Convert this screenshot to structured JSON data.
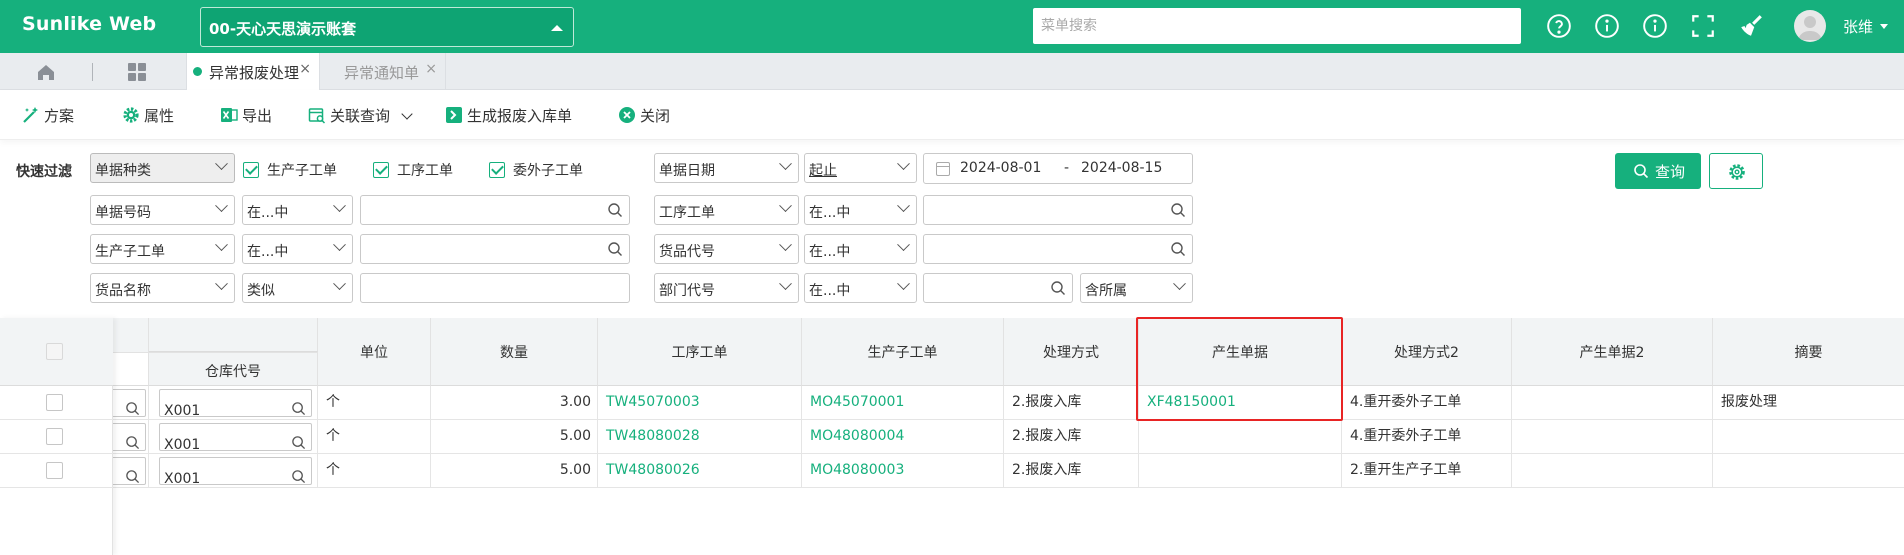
{
  "header": {
    "logo": "Sunlike Web",
    "company": "00-天心天思演示账套",
    "menu_search_placeholder": "菜单搜索",
    "user_name": "张维",
    "brand_color": "#16b07d",
    "icons": [
      "help-circle-icon",
      "info-icon",
      "info-icon",
      "fullscreen-icon",
      "broom-icon"
    ]
  },
  "tabs": {
    "active_label": "异常报废处理",
    "inactive_label": "异常通知单",
    "close_glyph": "×"
  },
  "toolbar": {
    "plan": "方案",
    "attribute": "属性",
    "export": "导出",
    "related_query": "关联查询",
    "generate": "生成报废入库单",
    "close": "关闭"
  },
  "filters": {
    "quick_filter_label": "快速过滤",
    "doc_type": "单据种类",
    "chk_production_sub": "生产子工单",
    "chk_process_order": "工序工单",
    "chk_outsource_sub": "委外子工单",
    "doc_date": "单据日期",
    "range_op": "起止",
    "date_from": "2024-08-01",
    "date_sep": "-",
    "date_to": "2024-08-15",
    "row2_field": "单据号码",
    "row2_op": "在...中",
    "row2_right_field": "工序工单",
    "row2_right_op": "在...中",
    "row3_field": "生产子工单",
    "row3_op": "在...中",
    "row3_right_field": "货品代号",
    "row3_right_op": "在...中",
    "row4_field": "货品名称",
    "row4_op": "类似",
    "row4_right_field": "部门代号",
    "row4_right_op": "在...中",
    "row4_include": "含所属",
    "query_button": "查询"
  },
  "grid": {
    "columns": {
      "warehouse": "仓库代号",
      "unit": "单位",
      "qty": "数量",
      "process_order": "工序工单",
      "production_sub": "生产子工单",
      "method": "处理方式",
      "generated_doc": "产生单据",
      "method2": "处理方式2",
      "generated_doc2": "产生单据2",
      "summary": "摘要"
    },
    "rows": [
      {
        "warehouse": "X001",
        "unit": "个",
        "qty": "3.00",
        "process_order": "TW45070003",
        "production_sub": "MO45070001",
        "method": "2.报废入库",
        "generated_doc": "XF48150001",
        "method2": "4.重开委外子工单",
        "generated_doc2": "",
        "summary": "报废处理"
      },
      {
        "warehouse": "X001",
        "unit": "个",
        "qty": "5.00",
        "process_order": "TW48080028",
        "production_sub": "MO48080004",
        "method": "2.报废入库",
        "generated_doc": "",
        "method2": "4.重开委外子工单",
        "generated_doc2": "",
        "summary": ""
      },
      {
        "warehouse": "X001",
        "unit": "个",
        "qty": "5.00",
        "process_order": "TW48080026",
        "production_sub": "MO48080003",
        "method": "2.报废入库",
        "generated_doc": "",
        "method2": "2.重开生产子工单",
        "generated_doc2": "",
        "summary": ""
      }
    ]
  }
}
